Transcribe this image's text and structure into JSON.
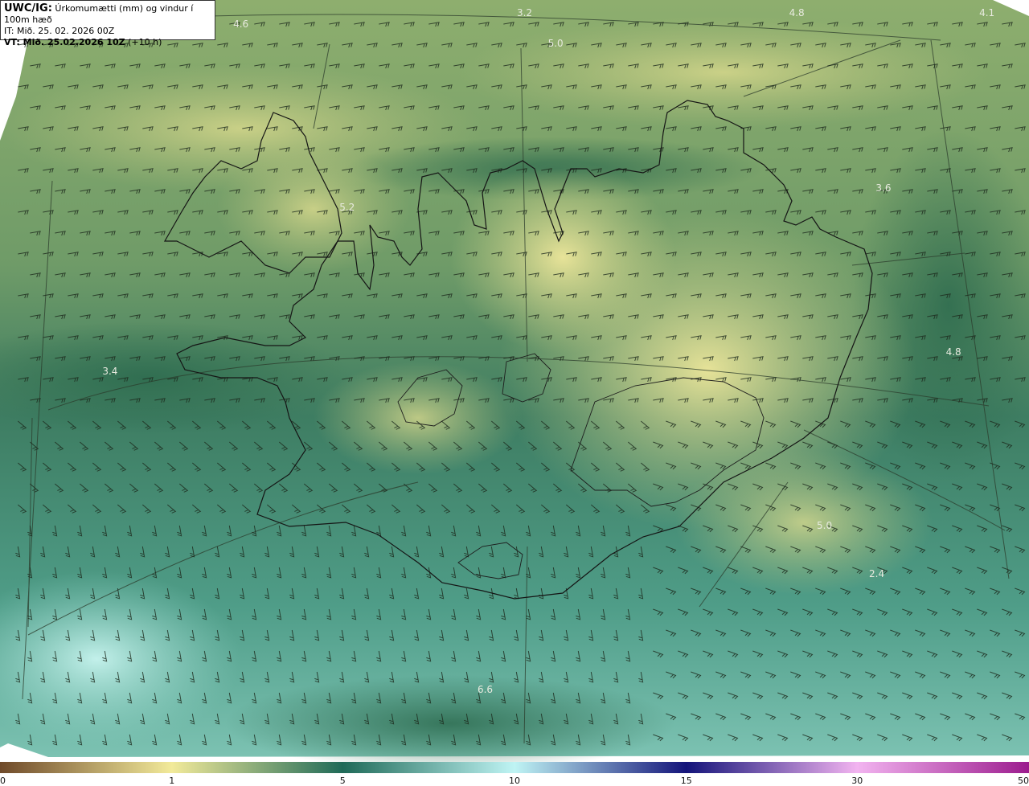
{
  "header": {
    "model": "UWC/IG:",
    "title": "Úrkomumætti (mm) og vindur í 100m hæð",
    "init_time": "IT: Mið. 25. 02. 2026 00Z",
    "valid_prefix": "VT: Mið. 25.02.2026 10Z",
    "lead": "(+10 h)"
  },
  "value_labels": [
    {
      "text": "3.2",
      "lon": -18.45,
      "lat": 67.55
    },
    {
      "text": "4.8",
      "lon": -14.4,
      "lat": 67.5
    },
    {
      "text": "4.1",
      "lon": -11.6,
      "lat": 67.3
    },
    {
      "text": "4.6",
      "lon": -22.6,
      "lat": 66.65
    },
    {
      "text": "5.0",
      "lon": -18.0,
      "lat": 66.55
    },
    {
      "text": "3.6",
      "lon": -13.3,
      "lat": 65.8
    },
    {
      "text": "5.2",
      "lon": -21.0,
      "lat": 65.7
    },
    {
      "text": "4.8",
      "lon": -12.4,
      "lat": 64.95
    },
    {
      "text": "3.4",
      "lon": -24.3,
      "lat": 64.85
    },
    {
      "text": "5.0",
      "lon": -14.3,
      "lat": 64.05
    },
    {
      "text": "2.4",
      "lon": -13.6,
      "lat": 63.8
    },
    {
      "text": "6.6",
      "lon": -19.0,
      "lat": 63.2
    }
  ],
  "colorbar": {
    "stops": [
      {
        "v": 0,
        "color": "#6f4a2a"
      },
      {
        "v": 1,
        "color": "#f2ea9a"
      },
      {
        "v": 5,
        "color": "#1f6a58"
      },
      {
        "v": 10,
        "color": "#bff4f4"
      },
      {
        "v": 15,
        "color": "#14147a"
      },
      {
        "v": 30,
        "color": "#f2b4f0"
      },
      {
        "v": 50,
        "color": "#9c1c8e"
      }
    ],
    "ticks": [
      "0",
      "1",
      "5",
      "10",
      "15",
      "30",
      "50"
    ]
  }
}
